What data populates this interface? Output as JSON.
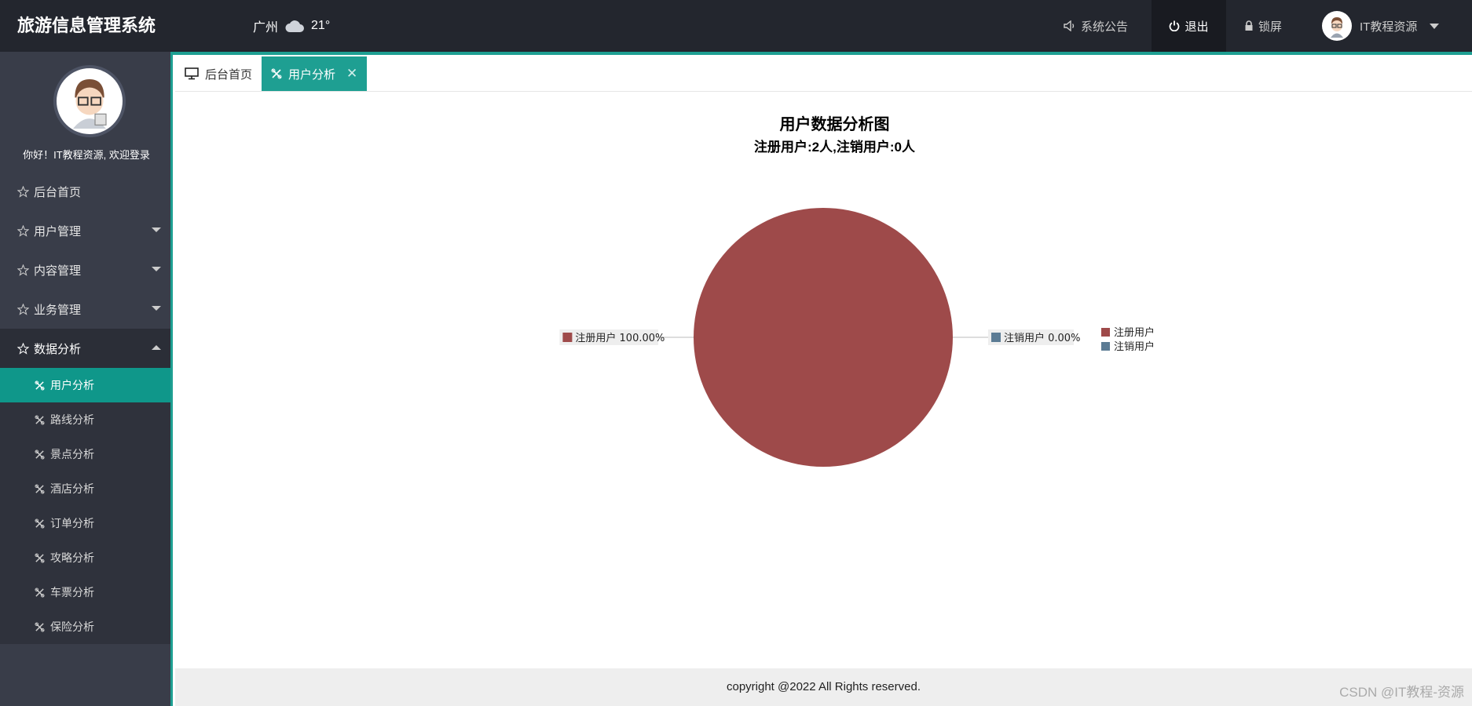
{
  "app": {
    "title": "旅游信息管理系统"
  },
  "weather": {
    "city": "广州",
    "temp": "21°",
    "icon": "cloud-icon"
  },
  "header": {
    "notice": "系统公告",
    "logout": "退出",
    "lock": "锁屏",
    "user": "IT教程资源"
  },
  "sidebar": {
    "welcome": "你好！IT教程资源, 欢迎登录",
    "items": [
      {
        "label": "后台首页"
      },
      {
        "label": "用户管理"
      },
      {
        "label": "内容管理"
      },
      {
        "label": "业务管理"
      },
      {
        "label": "数据分析"
      }
    ],
    "sub_items": [
      {
        "label": "用户分析"
      },
      {
        "label": "路线分析"
      },
      {
        "label": "景点分析"
      },
      {
        "label": "酒店分析"
      },
      {
        "label": "订单分析"
      },
      {
        "label": "攻略分析"
      },
      {
        "label": "车票分析"
      },
      {
        "label": "保险分析"
      }
    ]
  },
  "tabs": [
    {
      "label": "后台首页"
    },
    {
      "label": "用户分析"
    }
  ],
  "chart_data": {
    "type": "pie",
    "title": "用户数据分析图",
    "subtitle": "注册用户:2人,注销用户:0人",
    "categories": [
      "注册用户",
      "注销用户"
    ],
    "values": [
      2,
      0
    ],
    "labels": [
      "注册用户 100.00%",
      "注销用户 0.00%"
    ],
    "colors": [
      "#9e4a4a",
      "#5b7b94"
    ],
    "legend": "right"
  },
  "footer": {
    "copyright": "copyright @2022 All Rights reserved."
  },
  "watermark": "CSDN @IT教程-资源"
}
